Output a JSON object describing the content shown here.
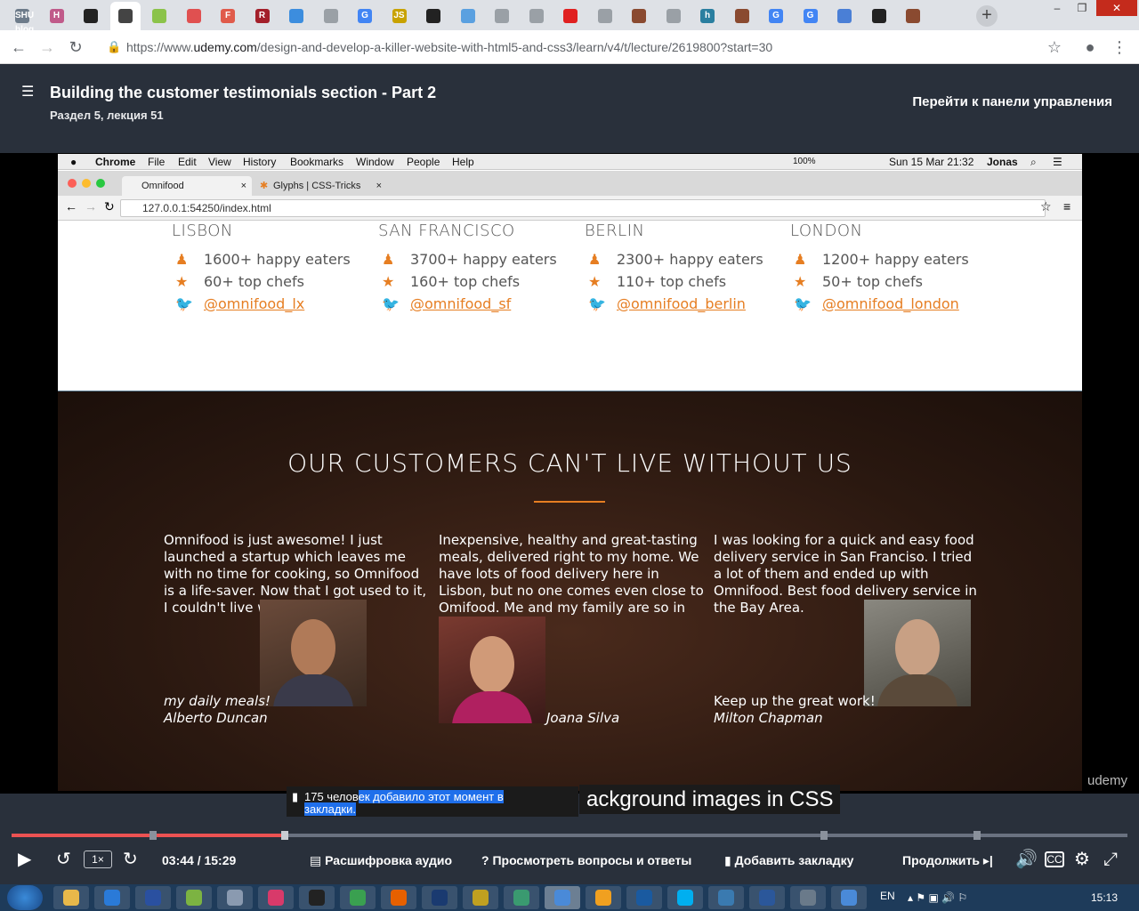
{
  "browser": {
    "url_prefix": "https://www.",
    "url_host": "udemy.com",
    "url_path": "/design-and-develop-a-killer-website-with-html5-and-css3/learn/v4/t/lecture/2619800?start=30",
    "tabs": [
      {
        "icon": "shu-blog-icon",
        "text": "SHU blog",
        "color": "#6d7b8a"
      },
      {
        "icon": "h-icon",
        "text": "H",
        "color": "#c05a8a"
      },
      {
        "icon": "github-icon",
        "text": "",
        "color": "#222"
      },
      {
        "icon": "speaker-icon",
        "text": "",
        "color": "#444",
        "active": true
      },
      {
        "icon": "android-icon",
        "text": "",
        "color": "#8bc34a"
      },
      {
        "icon": "diamond-icon",
        "text": "",
        "color": "#e05050"
      },
      {
        "icon": "f-icon",
        "text": "F",
        "color": "#e05b4b"
      },
      {
        "icon": "r-icon",
        "text": "R",
        "color": "#a31f2a"
      },
      {
        "icon": "grid-icon",
        "text": "",
        "color": "#3c8dde"
      },
      {
        "icon": "folder-icon",
        "text": "",
        "color": "#9aa0a6"
      },
      {
        "icon": "google-icon",
        "text": "G",
        "color": "#4285f4"
      },
      {
        "icon": "js-icon",
        "text": "JS",
        "color": "#c8a200"
      },
      {
        "icon": "x-box-icon",
        "text": "",
        "color": "#222"
      },
      {
        "icon": "heart-icon",
        "text": "",
        "color": "#5aa0e0"
      },
      {
        "icon": "doc-icon",
        "text": "",
        "color": "#9aa0a6"
      },
      {
        "icon": "doc-icon",
        "text": "",
        "color": "#9aa0a6"
      },
      {
        "icon": "youtube-icon",
        "text": "",
        "color": "#e02020"
      },
      {
        "icon": "doc-icon",
        "text": "",
        "color": "#9aa0a6"
      },
      {
        "icon": "brown-grid-icon",
        "text": "",
        "color": "#8a4a30"
      },
      {
        "icon": "doc-icon",
        "text": "",
        "color": "#9aa0a6"
      },
      {
        "icon": "h-icon",
        "text": "h",
        "color": "#2a7fa0"
      },
      {
        "icon": "brown-grid-icon",
        "text": "",
        "color": "#8a4a30"
      },
      {
        "icon": "google-icon",
        "text": "G",
        "color": "#4285f4"
      },
      {
        "icon": "google-icon",
        "text": "G",
        "color": "#4285f4"
      },
      {
        "icon": "circle-icon",
        "text": "",
        "color": "#4a7fd6"
      },
      {
        "icon": "github-icon",
        "text": "",
        "color": "#222"
      },
      {
        "icon": "brown-grid-icon",
        "text": "",
        "color": "#8a4a30"
      }
    ]
  },
  "udemy": {
    "lecture_title": "Building the customer testimonials section - Part 2",
    "lecture_sub": "Раздел 5, лекция 51",
    "dashboard_link": "Перейти к панели управления",
    "watermark": "udemy"
  },
  "mac": {
    "menu": [
      "Chrome",
      "File",
      "Edit",
      "View",
      "History",
      "Bookmarks",
      "Window",
      "People",
      "Help"
    ],
    "status": {
      "battery": "100%",
      "datetime": "Sun 15 Mar  21:32",
      "user": "Jonas"
    },
    "tabs": [
      "Omnifood",
      "Glyphs | CSS-Tricks"
    ],
    "url": "127.0.0.1:54250/index.html"
  },
  "cities": [
    {
      "name": "Lisbon",
      "eaters": "1600+ happy eaters",
      "chefs": "60+ top chefs",
      "twitter": "@omnifood_lx"
    },
    {
      "name": "San Francisco",
      "eaters": "3700+ happy eaters",
      "chefs": "160+ top chefs",
      "twitter": "@omnifood_sf"
    },
    {
      "name": "Berlin",
      "eaters": "2300+ happy eaters",
      "chefs": "110+ top chefs",
      "twitter": "@omnifood_berlin"
    },
    {
      "name": "London",
      "eaters": "1200+ happy eaters",
      "chefs": "50+ top chefs",
      "twitter": "@omnifood_london"
    }
  ],
  "testimonials": {
    "title": "OUR CUSTOMERS CAN'T LIVE WITHOUT US",
    "items": [
      {
        "quote": "Omnifood is just awesome! I just launched a startup which leaves me with no time for cooking, so Omnifood is a life-saver. Now that I got used to it, I couldn't live without",
        "tail": "my daily meals!",
        "author": "Alberto Duncan"
      },
      {
        "quote": "Inexpensive, healthy and great-tasting meals, delivered right to my home. We have lots of food delivery here in Lisbon, but no one comes even close to Omifood. Me and my family are so in love!",
        "tail": "",
        "author": "Joana Silva"
      },
      {
        "quote": "I was looking for a quick and easy food delivery service in San Franciso. I tried a lot of them and ended up with Omnifood. Best food delivery service in the Bay Area.",
        "tail": "Keep up the great work!",
        "author": "Milton Chapman"
      }
    ]
  },
  "overlay": {
    "bookmark_note_a": "175 челов",
    "bookmark_note_b": "ек добавило этот момент в",
    "bookmark_note_c": "закладки.",
    "caption": "ackground images in CSS"
  },
  "player": {
    "progress": 0.245,
    "speed": "1×",
    "time": "03:44 / 15:29",
    "transcript": "Расшифровка аудио",
    "qa": "Просмотреть вопросы и ответы",
    "bookmark": "Добавить закладку",
    "continue": "Продолжить"
  },
  "taskbar": {
    "lang": "EN",
    "clock": "15:13",
    "apps": [
      {
        "icon": "explorer-icon",
        "color": "#e8b84a"
      },
      {
        "icon": "chat-icon",
        "color": "#2a7ad8"
      },
      {
        "icon": "floppy-icon",
        "color": "#2a50a0"
      },
      {
        "icon": "android-studio-icon",
        "color": "#7cb342"
      },
      {
        "icon": "box-icon",
        "color": "#8a9ab0"
      },
      {
        "icon": "oo-icon",
        "color": "#d83a6a"
      },
      {
        "icon": "intellij-icon",
        "color": "#222"
      },
      {
        "icon": "leaf-icon",
        "color": "#3aa050"
      },
      {
        "icon": "firefox-icon",
        "color": "#e66000"
      },
      {
        "icon": "photoshop-icon",
        "color": "#1a3a70"
      },
      {
        "icon": "flag-icon",
        "color": "#c0a020"
      },
      {
        "icon": "gear-green-icon",
        "color": "#3a9a70"
      },
      {
        "icon": "chrome-icon",
        "color": "#4a8ad8",
        "active": true
      },
      {
        "icon": "sublime-icon",
        "color": "#f0a020"
      },
      {
        "icon": "window-icon",
        "color": "#1a5aa0"
      },
      {
        "icon": "skype-icon",
        "color": "#00aff0"
      },
      {
        "icon": "calc-icon",
        "color": "#3a7ab0"
      },
      {
        "icon": "word-icon",
        "color": "#2b579a"
      },
      {
        "icon": "car-icon",
        "color": "#6a7a8a"
      },
      {
        "icon": "chrome-icon",
        "color": "#4a8ad8"
      }
    ]
  }
}
